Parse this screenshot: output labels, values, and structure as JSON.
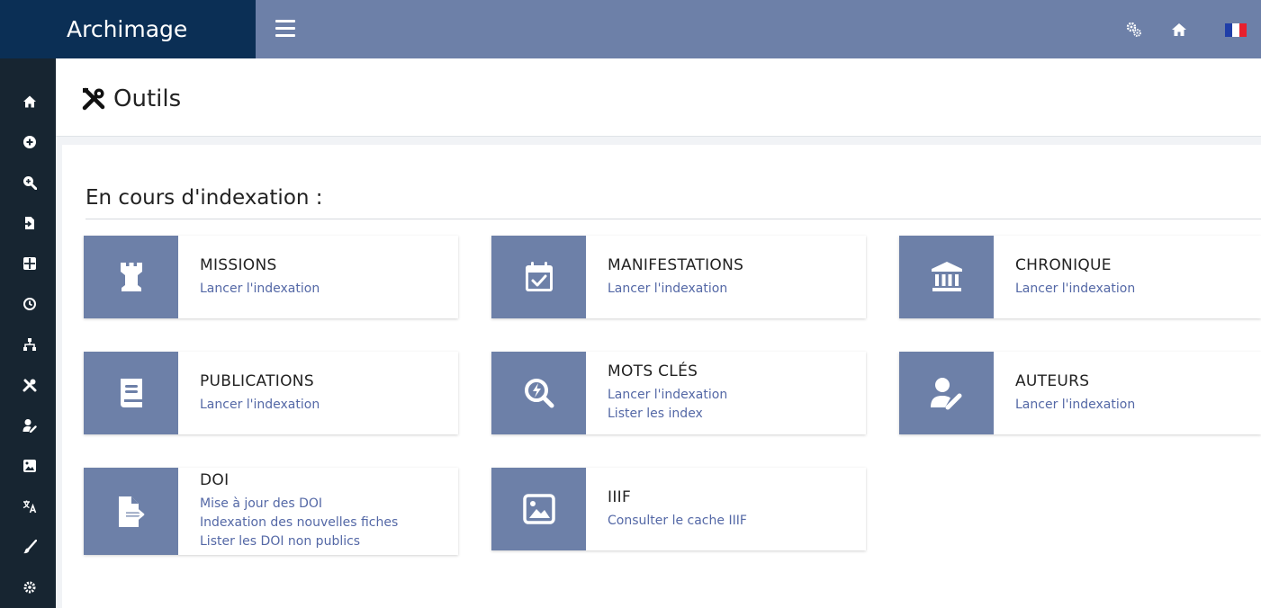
{
  "app": {
    "title": "Archimage"
  },
  "page": {
    "title": "Outils"
  },
  "section": {
    "title": "En cours d'indexation :"
  },
  "colors": {
    "brand": "#0b2f55",
    "topbar": "#6d80a8",
    "sidebar": "#172531",
    "accent": "#6d80a8",
    "link": "#5468a6"
  },
  "topbar": {
    "icons": [
      "cogs-icon",
      "home-icon",
      "french-flag-icon"
    ]
  },
  "sidebar": {
    "icons": [
      "home-icon",
      "add-circle-icon",
      "search-plus-icon",
      "import-icon",
      "grid-icon",
      "history-icon",
      "network-icon",
      "tools-icon",
      "user-edit-icon",
      "image-icon",
      "translate-icon",
      "brush-icon",
      "settings-icon"
    ]
  },
  "cards": [
    {
      "title": "MISSIONS",
      "icon": "chess-rook-icon",
      "links": [
        "Lancer l'indexation"
      ]
    },
    {
      "title": "MANIFESTATIONS",
      "icon": "calendar-check-icon",
      "links": [
        "Lancer l'indexation"
      ]
    },
    {
      "title": "CHRONIQUE",
      "icon": "landmark-icon",
      "links": [
        "Lancer l'indexation"
      ]
    },
    {
      "title": "PUBLICATIONS",
      "icon": "book-icon",
      "links": [
        "Lancer l'indexation"
      ]
    },
    {
      "title": "MOTS CLÉS",
      "icon": "search-bolt-icon",
      "links": [
        "Lancer l'indexation",
        "Lister les index"
      ]
    },
    {
      "title": "AUTEURS",
      "icon": "user-pen-icon",
      "links": [
        "Lancer l'indexation"
      ]
    },
    {
      "title": "DOI",
      "icon": "file-export-icon",
      "links": [
        "Mise à jour des DOI",
        "Indexation des nouvelles fiches",
        "Lister les DOI non publics"
      ]
    },
    {
      "title": "IIIF",
      "icon": "image-icon",
      "links": [
        "Consulter le cache IIIF"
      ]
    }
  ]
}
